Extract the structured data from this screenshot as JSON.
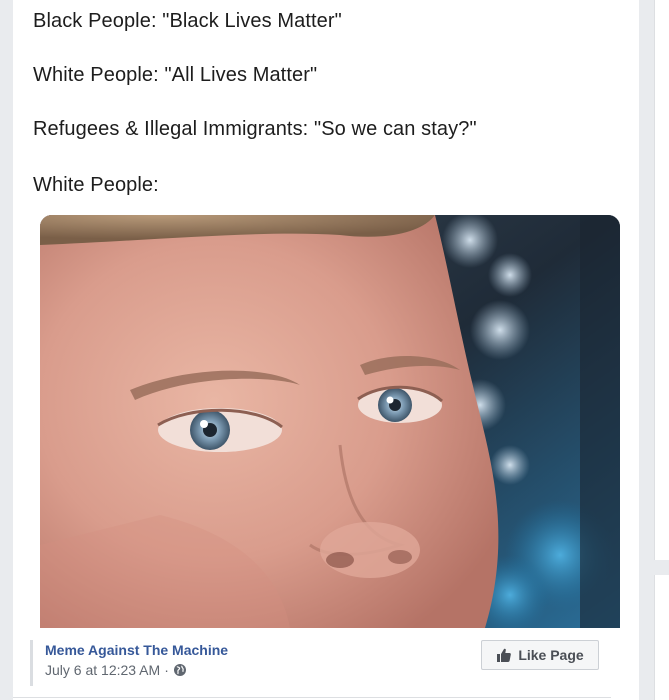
{
  "meme": {
    "lines": [
      "Black People: \"Black Lives Matter\"",
      "White People: \"All Lives Matter\"",
      "Refugees & Illegal Immigrants: \"So we can stay?\"",
      "White People:"
    ]
  },
  "attribution": {
    "page_name": "Meme Against The Machine",
    "timestamp": "July 6 at 12:23 AM",
    "separator": "·",
    "privacy_icon": "globe-icon"
  },
  "like_page_button": {
    "label": "Like Page",
    "icon": "thumbs-up-icon"
  },
  "colors": {
    "link_blue": "#365899",
    "meta_gray": "#606770",
    "page_background": "#e9ebee"
  }
}
